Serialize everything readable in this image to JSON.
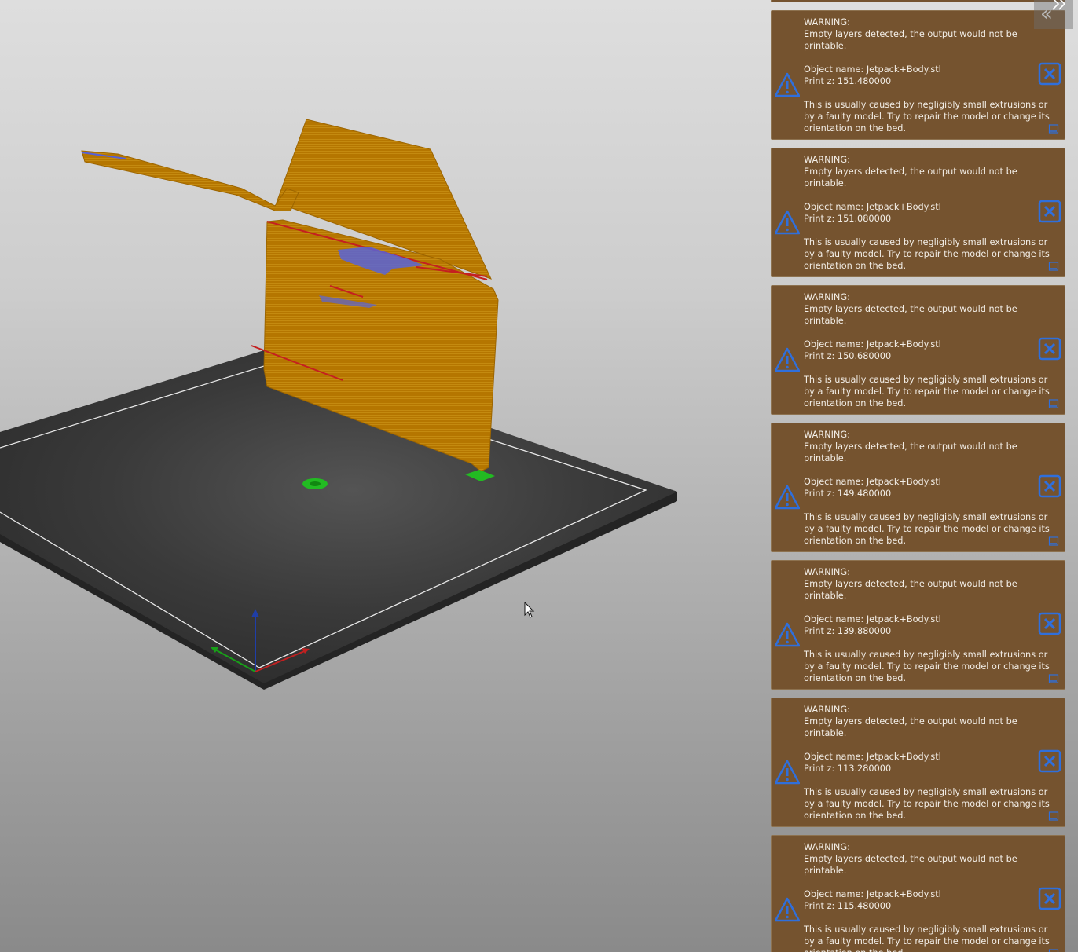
{
  "viewport": {
    "name": "3D preview",
    "axes": [
      "x-axis",
      "y-axis",
      "z-axis"
    ]
  },
  "sidebar_toggle": {
    "collapse_icon": "double-chevron-left-icon",
    "expand_icon": "double-chevron-right-icon"
  },
  "colors": {
    "notification_bg": "#75532f",
    "notification_border": "#8d7250",
    "icon_blue": "#2f6fdc",
    "model_orange": "#b37400",
    "bed_dark": "#333333"
  },
  "notifications": [
    {
      "heading": "WARNING:",
      "line1": "Empty layers detected, the output would not be",
      "line2": "printable.",
      "object": "Object name: Jetpack+Body.stl",
      "print_z": "Print z: 151.480000",
      "hint1": "This is usually caused by negligibly small extrusions or",
      "hint2": "by a faulty model. Try to repair the model or change its",
      "hint3": "orientation on the bed."
    },
    {
      "heading": "WARNING:",
      "line1": "Empty layers detected, the output would not be",
      "line2": "printable.",
      "object": "Object name: Jetpack+Body.stl",
      "print_z": "Print z: 151.080000",
      "hint1": "This is usually caused by negligibly small extrusions or",
      "hint2": "by a faulty model. Try to repair the model or change its",
      "hint3": "orientation on the bed."
    },
    {
      "heading": "WARNING:",
      "line1": "Empty layers detected, the output would not be",
      "line2": "printable.",
      "object": "Object name: Jetpack+Body.stl",
      "print_z": "Print z: 150.680000",
      "hint1": "This is usually caused by negligibly small extrusions or",
      "hint2": "by a faulty model. Try to repair the model or change its",
      "hint3": "orientation on the bed."
    },
    {
      "heading": "WARNING:",
      "line1": "Empty layers detected, the output would not be",
      "line2": "printable.",
      "object": "Object name: Jetpack+Body.stl",
      "print_z": "Print z: 149.480000",
      "hint1": "This is usually caused by negligibly small extrusions or",
      "hint2": "by a faulty model. Try to repair the model or change its",
      "hint3": "orientation on the bed."
    },
    {
      "heading": "WARNING:",
      "line1": "Empty layers detected, the output would not be",
      "line2": "printable.",
      "object": "Object name: Jetpack+Body.stl",
      "print_z": "Print z: 139.880000",
      "hint1": "This is usually caused by negligibly small extrusions or",
      "hint2": "by a faulty model. Try to repair the model or change its",
      "hint3": "orientation on the bed."
    },
    {
      "heading": "WARNING:",
      "line1": "Empty layers detected, the output would not be",
      "line2": "printable.",
      "object": "Object name: Jetpack+Body.stl",
      "print_z": "Print z: 113.280000",
      "hint1": "This is usually caused by negligibly small extrusions or",
      "hint2": "by a faulty model. Try to repair the model or change its",
      "hint3": "orientation on the bed."
    },
    {
      "heading": "WARNING:",
      "line1": "Empty layers detected, the output would not be",
      "line2": "printable.",
      "object": "Object name: Jetpack+Body.stl",
      "print_z": "Print z: 115.480000",
      "hint1": "This is usually caused by negligibly small extrusions or",
      "hint2": "by a faulty model. Try to repair the model or change its",
      "hint3": "orientation on the bed."
    }
  ]
}
